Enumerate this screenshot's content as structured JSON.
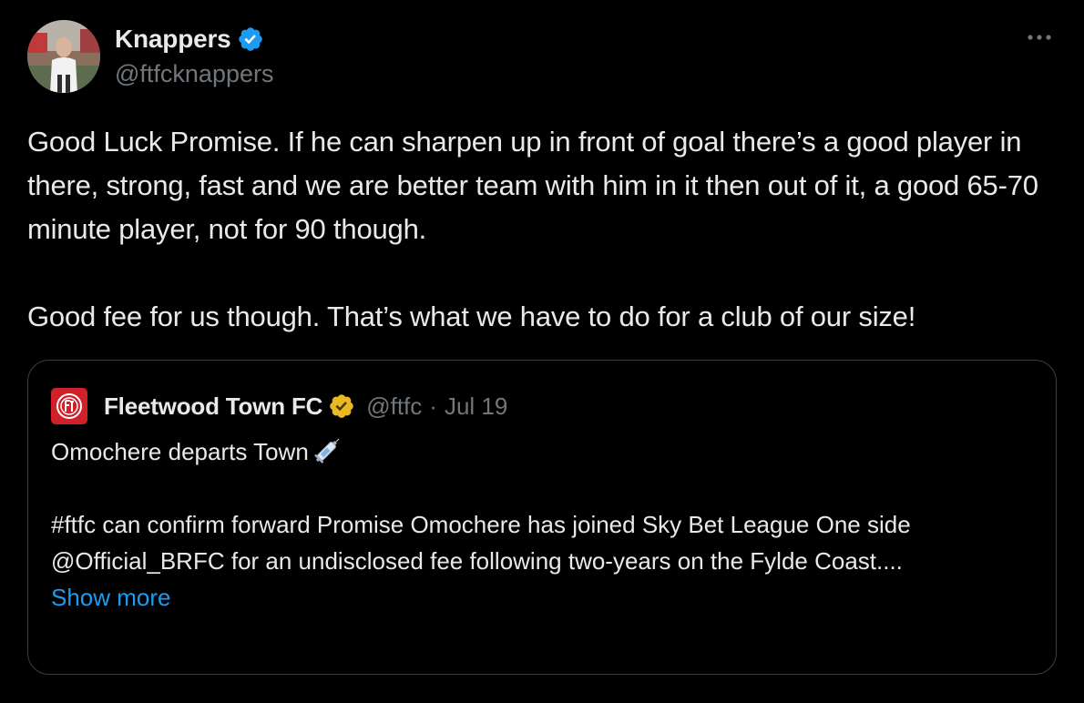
{
  "author": {
    "display_name": "Knappers",
    "handle": "@ftfcknappers",
    "verified_color": "#1d9bf0"
  },
  "icons": {
    "more": "more-options-icon",
    "verified": "verified-badge-icon",
    "quote_verified": "gold-verified-badge-icon",
    "emoji": "syringe-icon"
  },
  "tweet": {
    "paragraph_1": "Good Luck Promise. If he can sharpen up in front of goal there’s a good player in there, strong, fast and we are better team with him in it then out of it, a good 65-70 minute player, not for 90 though.",
    "paragraph_2": "Good fee for us though. That’s what we have to do for a club of our size!"
  },
  "quoted": {
    "display_name": "Fleetwood Town FC",
    "handle": "@ftfc",
    "separator": "·",
    "date": "Jul 19",
    "line_1": "Omochere departs Town",
    "line_2": "#ftfc can confirm forward Promise Omochere has joined Sky Bet League One side @Official_BRFC for an undisclosed fee following two-years on the Fylde Coast....",
    "show_more": "Show more",
    "verified_color": "#e8b923",
    "logo_color": "#d0202a"
  },
  "colors": {
    "background": "#000000",
    "text": "#e7e9ea",
    "secondary_text": "#71767b",
    "link": "#1d9bf0",
    "border": "#3a3f44"
  }
}
